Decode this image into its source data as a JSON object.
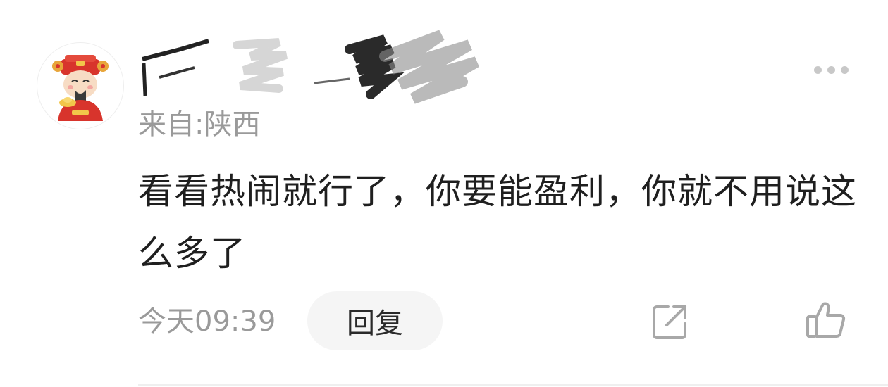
{
  "comment": {
    "avatar_icon": "god-of-wealth-avatar-icon",
    "username_redacted": true,
    "location": "来自:陕西",
    "text": "看看热闹就行了，你要能盈利，你就不用说这么多了",
    "time": "今天09:39",
    "reply_label": "回复",
    "more_icon": "more-dots-icon",
    "share_icon": "share-icon",
    "like_icon": "thumbs-up-icon"
  },
  "colors": {
    "text_primary": "#1f1f1f",
    "text_secondary": "#9a9a9a",
    "reply_bg": "#f5f5f5",
    "icon_gray": "#a8a8a8"
  }
}
